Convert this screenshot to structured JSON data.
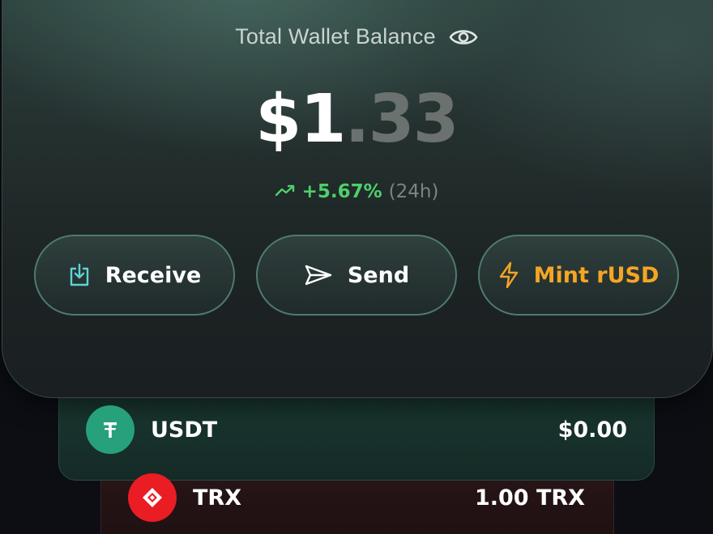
{
  "header": {
    "title": "Total Wallet Balance",
    "visibility_icon": "eye-icon"
  },
  "balance": {
    "integer_part": "$1",
    "decimal_part": ".33"
  },
  "change": {
    "icon": "trend-up-icon",
    "value": "+5.67%",
    "period": "(24h)",
    "color": "#4fcf6b"
  },
  "actions": [
    {
      "label": "Receive",
      "icon": "download-icon"
    },
    {
      "label": "Send",
      "icon": "send-icon"
    },
    {
      "label": "Mint rUSD",
      "icon": "lightning-icon",
      "color": "#f5a524"
    }
  ],
  "assets": [
    {
      "name": "USDT",
      "value": "$0.00",
      "icon": "tether-icon",
      "color": "#26a17b"
    },
    {
      "name": "TRX",
      "value": "1.00 TRX",
      "icon": "tron-icon",
      "color": "#ea1c24"
    }
  ]
}
